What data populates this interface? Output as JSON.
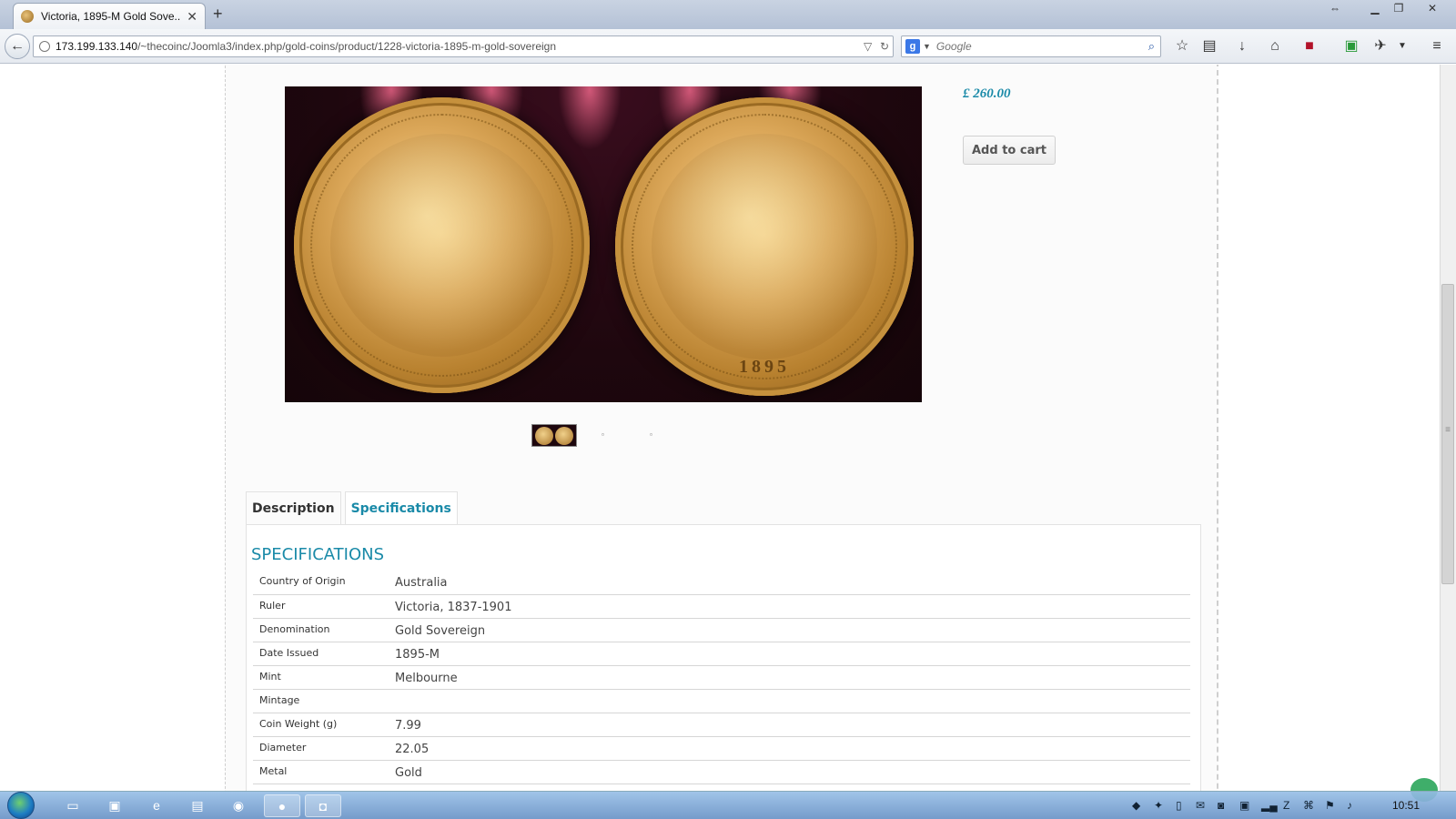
{
  "browser": {
    "tab_title": "Victoria, 1895-M Gold Sove...",
    "url_host": "173.199.133.140",
    "url_path": "/~thecoinc/Joomla3/index.php/gold-coins/product/1228-victoria-1895-m-gold-sovereign",
    "search_placeholder": "Google",
    "search_engine_letter": "g"
  },
  "product": {
    "price": "£ 260.00",
    "add_to_cart": "Add to cart",
    "coin_year": "1895"
  },
  "tabs": [
    {
      "label": "Description"
    },
    {
      "label": "Specifications"
    }
  ],
  "specs": {
    "heading": "SPECIFICATIONS",
    "rows": [
      {
        "key": "Country of Origin",
        "value": "Australia"
      },
      {
        "key": "Ruler",
        "value": "Victoria, 1837-1901"
      },
      {
        "key": "Denomination",
        "value": "Gold Sovereign"
      },
      {
        "key": "Date Issued",
        "value": "1895-M"
      },
      {
        "key": "Mint",
        "value": "Melbourne"
      },
      {
        "key": "Mintage",
        "value": ""
      },
      {
        "key": "Coin Weight (g)",
        "value": "7.99"
      },
      {
        "key": "Diameter",
        "value": "22.05"
      },
      {
        "key": "Metal",
        "value": "Gold"
      }
    ]
  },
  "taskbar": {
    "clock": "10:51"
  },
  "colors": {
    "accent": "#1a8aa8"
  }
}
